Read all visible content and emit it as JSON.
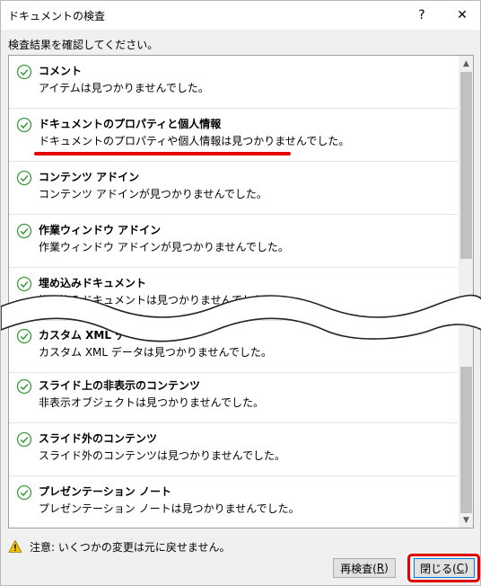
{
  "window": {
    "title": "ドキュメントの検査",
    "help_glyph": "?",
    "close_glyph": "✕"
  },
  "instruction": "検査結果を確認してください。",
  "results": [
    {
      "heading": "コメント",
      "detail": "アイテムは見つかりませんでした。"
    },
    {
      "heading": "ドキュメントのプロパティと個人情報",
      "detail": "ドキュメントのプロパティや個人情報は見つかりませんでした。"
    },
    {
      "heading": "コンテンツ アドイン",
      "detail": "コンテンツ アドインが見つかりませんでした。"
    },
    {
      "heading": "作業ウィンドウ アドイン",
      "detail": "作業ウィンドウ アドインが見つかりませんでした。"
    },
    {
      "heading": "埋め込みドキュメント",
      "detail": "埋め込みドキュメントは見つかりませんでした。"
    },
    {
      "heading": "カスタム XML データ",
      "detail": "カスタム XML データは見つかりませんでした。"
    },
    {
      "heading": "スライド上の非表示のコンテンツ",
      "detail": "非表示オブジェクトは見つかりませんでした。"
    },
    {
      "heading": "スライド外のコンテンツ",
      "detail": "スライド外のコンテンツは見つかりませんでした。"
    },
    {
      "heading": "プレゼンテーション ノート",
      "detail": "プレゼンテーション ノートは見つかりませんでした。"
    }
  ],
  "warning": "注意: いくつかの変更は元に戻せません。",
  "buttons": {
    "reinspect_label": "再検査(",
    "reinspect_key": "R",
    "reinspect_end": ")",
    "close_label": "閉じる(",
    "close_key": "C",
    "close_end": ")"
  },
  "colors": {
    "check": "#3a9a3a",
    "annotation_red": "#e30000",
    "warning_yellow": "#f2c200"
  },
  "icons": {
    "result_status": "check-circle-icon",
    "warning": "warning-triangle-icon"
  }
}
